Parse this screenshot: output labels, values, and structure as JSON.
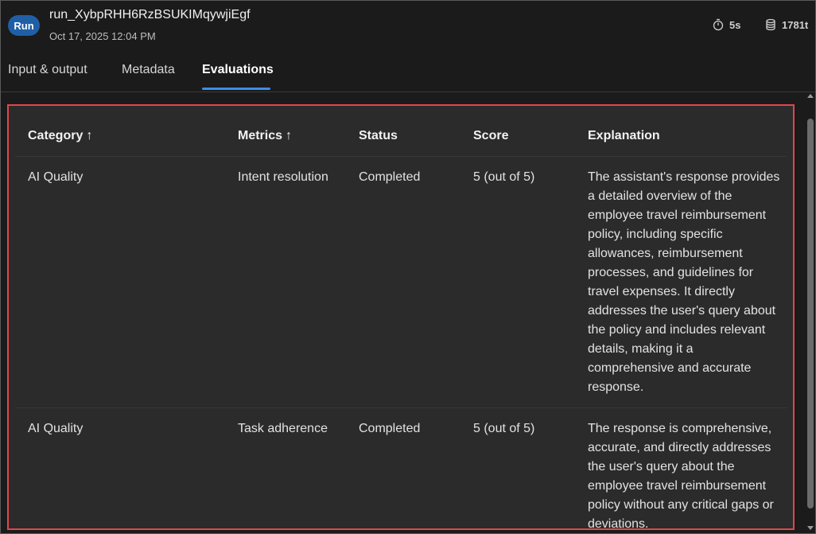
{
  "header": {
    "badge": "Run",
    "title": "run_XybpRHH6RzBSUKIMqywjiEgf",
    "date": "Oct 17, 2025 12:04 PM",
    "duration": "5s",
    "duration_icon": "timer-icon",
    "tokens": "1781t",
    "tokens_icon": "database-icon"
  },
  "tabs": [
    {
      "label": "Input & output",
      "active": false
    },
    {
      "label": "Metadata",
      "active": false
    },
    {
      "label": "Evaluations",
      "active": true
    }
  ],
  "table": {
    "headers": {
      "category": "Category",
      "metrics": "Metrics",
      "status": "Status",
      "score": "Score",
      "explanation": "Explanation",
      "sort_arrow": "↑"
    },
    "rows": [
      {
        "category": "AI Quality",
        "metrics": "Intent resolution",
        "status": "Completed",
        "score": "5 (out of 5)",
        "explanation": "The assistant's response provides a detailed overview of the employee travel reimbursement policy, including specific allowances, reimbursement processes, and guidelines for travel expenses. It directly addresses the user's query about the policy and includes relevant details, making it a comprehensive and accurate response."
      },
      {
        "category": "AI Quality",
        "metrics": "Task adherence",
        "status": "Completed",
        "score": "5 (out of 5)",
        "explanation": "The response is comprehensive, accurate, and directly addresses the user's query about the employee travel reimbursement policy without any critical gaps or deviations."
      }
    ]
  },
  "colors": {
    "accent": "#3d8ee8",
    "badge": "#1f5fa6",
    "highlight_border": "#e0474c"
  }
}
